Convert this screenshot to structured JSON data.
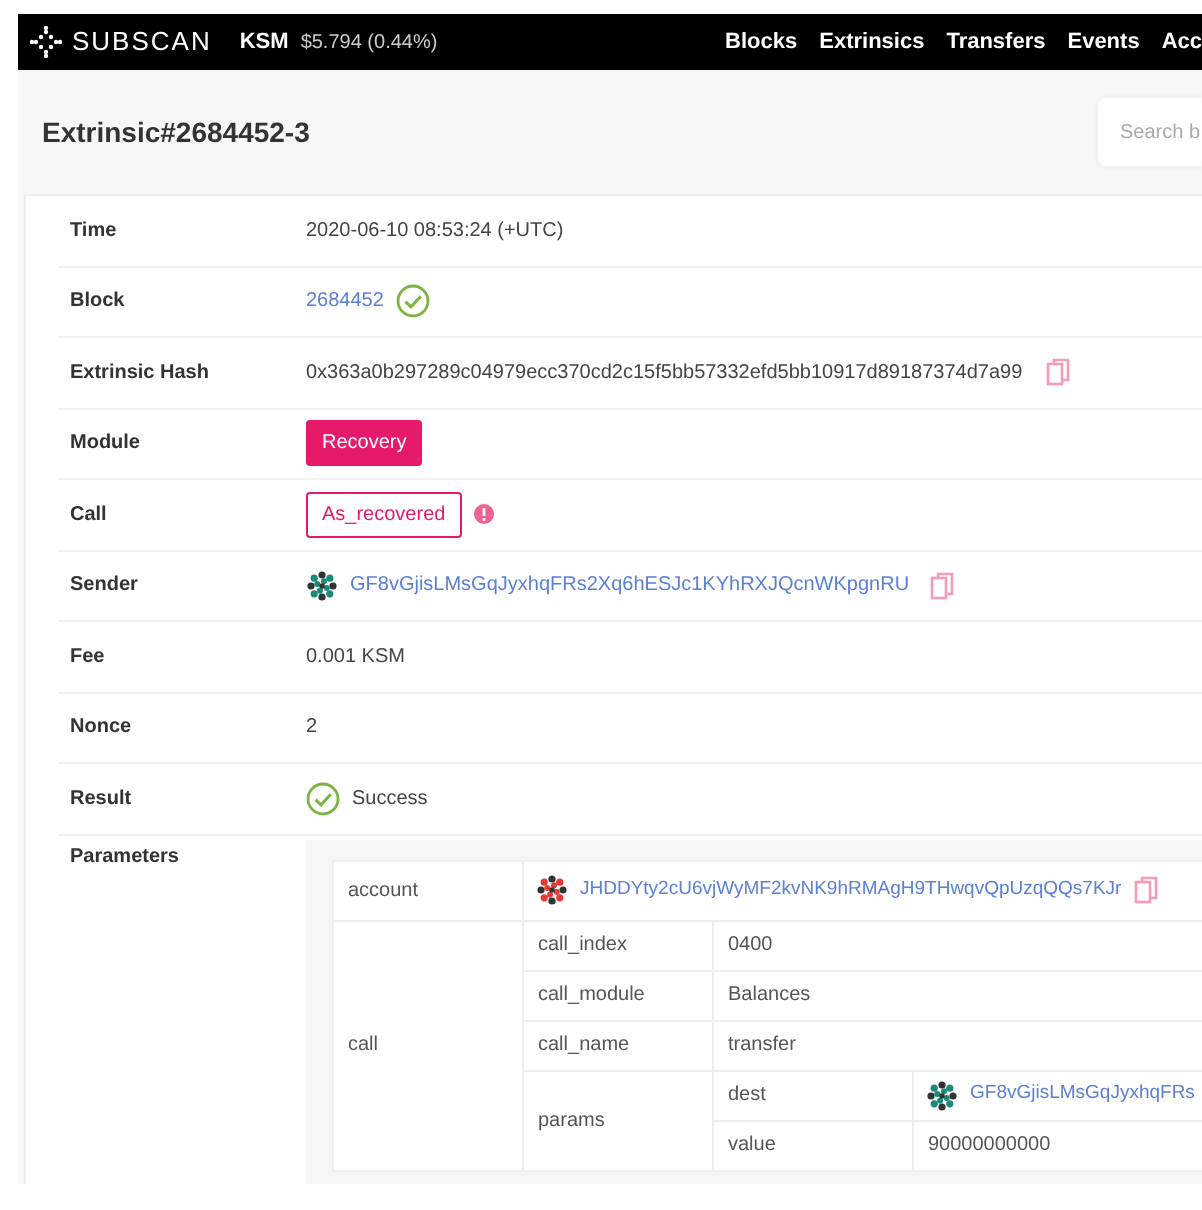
{
  "navbar": {
    "brand": "SUBSCAN",
    "token": "KSM",
    "price": "$5.794 (0.44%)",
    "links": [
      "Blocks",
      "Extrinsics",
      "Transfers",
      "Events",
      "Acc"
    ]
  },
  "header": {
    "title": "Extrinsic#2684452-3",
    "search": {
      "placeholder": "Search b"
    }
  },
  "details": [
    {
      "label": "Time",
      "kind": "text",
      "value": "2020-06-10 08:53:24 (+UTC)"
    },
    {
      "label": "Block",
      "kind": "block",
      "value": "2684452"
    },
    {
      "label": "Extrinsic Hash",
      "kind": "hash",
      "value": "0x363a0b297289c04979ecc370cd2c15f5bb57332efd5bb10917d89187374d7a99"
    },
    {
      "label": "Module",
      "kind": "module",
      "value": "Recovery"
    },
    {
      "label": "Call",
      "kind": "call",
      "value": "As_recovered"
    },
    {
      "label": "Sender",
      "kind": "address",
      "value": "GF8vGjisLMsGqJyxhqFRs2Xq6hESJc1KYhRXJQcnWKpgnRU"
    },
    {
      "label": "Fee",
      "kind": "text",
      "value": "0.001 KSM"
    },
    {
      "label": "Nonce",
      "kind": "text",
      "value": "2"
    },
    {
      "label": "Result",
      "kind": "result",
      "value": "Success"
    }
  ],
  "parameters": {
    "label": "Parameters",
    "account": {
      "key": "account",
      "value": "JHDDYty2cU6vjWyMF2kvNK9hRMAgH9THwqvQpUzqQQs7KJr"
    },
    "call": {
      "key": "call",
      "rows": [
        {
          "key": "call_index",
          "value": "0400"
        },
        {
          "key": "call_module",
          "value": "Balances"
        },
        {
          "key": "call_name",
          "value": "transfer"
        }
      ],
      "params": {
        "key": "params",
        "rows": [
          {
            "key": "dest",
            "kind": "address",
            "value": "GF8vGjisLMsGqJyxhqFRs"
          },
          {
            "key": "value",
            "kind": "text",
            "value": "90000000000"
          }
        ]
      }
    }
  }
}
